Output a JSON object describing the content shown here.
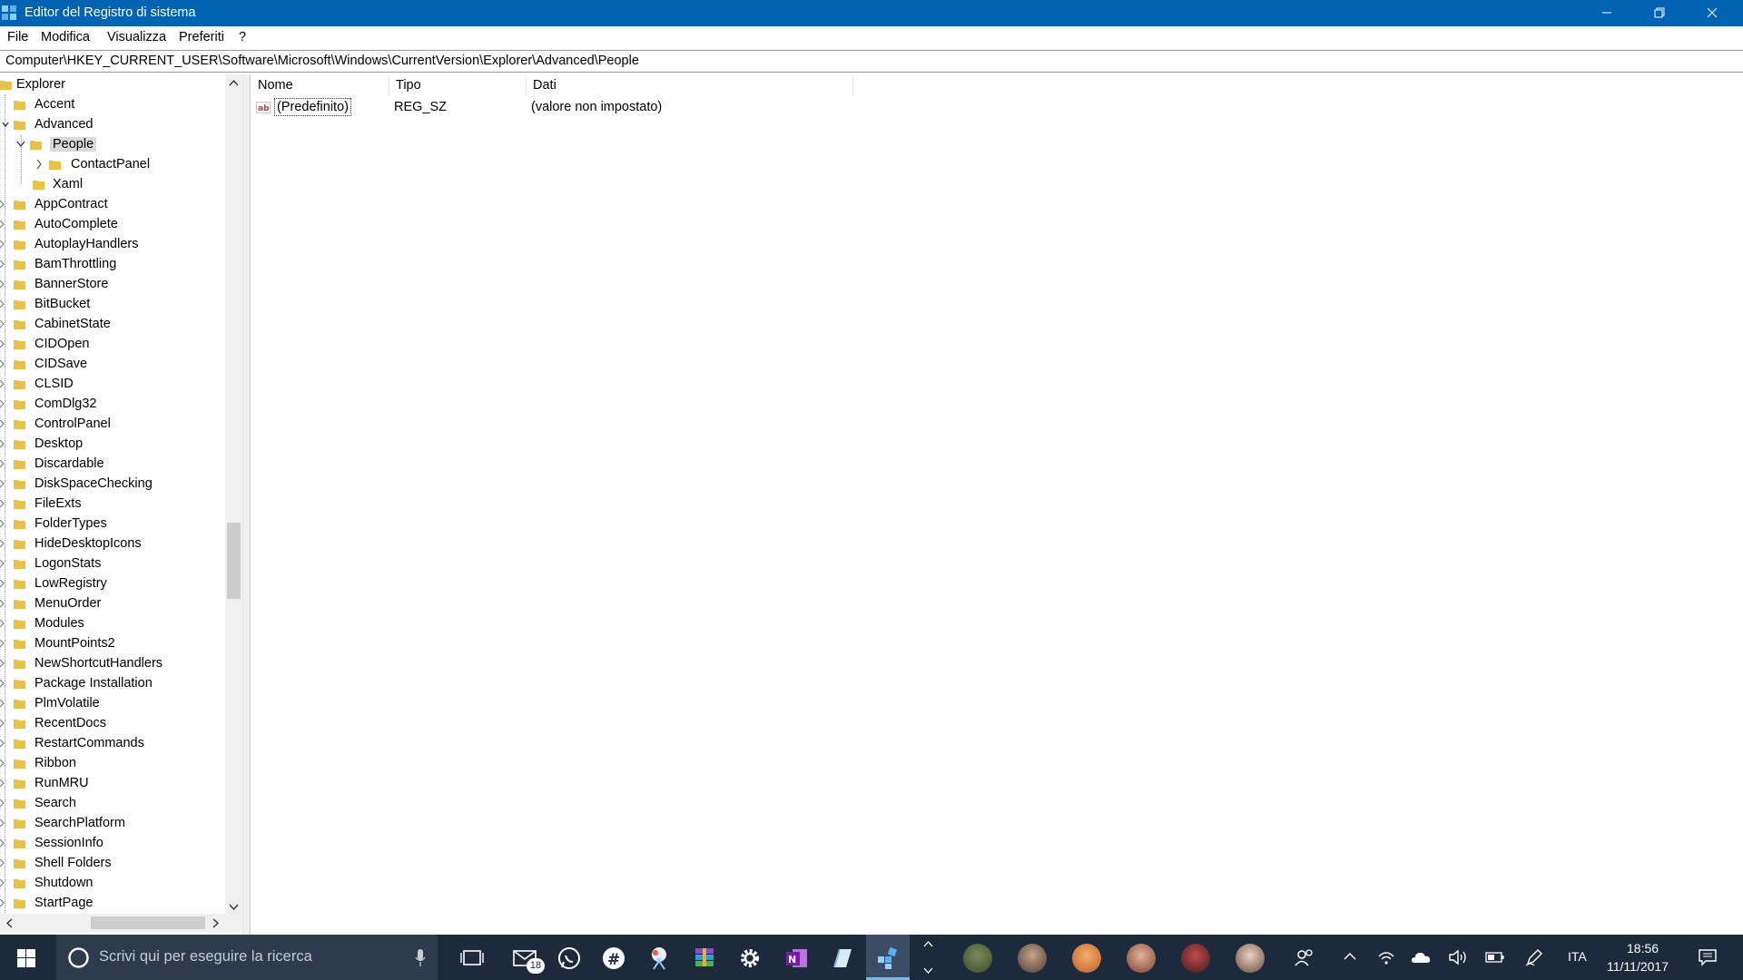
{
  "window": {
    "title": "Editor del Registro di sistema"
  },
  "menu": {
    "items": [
      "File",
      "Modifica",
      "Visualizza",
      "Preferiti",
      "?"
    ]
  },
  "address": {
    "path": "Computer\\HKEY_CURRENT_USER\\Software\\Microsoft\\Windows\\CurrentVersion\\Explorer\\Advanced\\People"
  },
  "tree": {
    "root": "Explorer",
    "accent": "Accent",
    "advanced": "Advanced",
    "people": "People",
    "contactpanel": "ContactPanel",
    "xaml": "Xaml",
    "siblings": [
      "AppContract",
      "AutoComplete",
      "AutoplayHandlers",
      "BamThrottling",
      "BannerStore",
      "BitBucket",
      "CabinetState",
      "CIDOpen",
      "CIDSave",
      "CLSID",
      "ComDlg32",
      "ControlPanel",
      "Desktop",
      "Discardable",
      "DiskSpaceChecking",
      "FileExts",
      "FolderTypes",
      "HideDesktopIcons",
      "LogonStats",
      "LowRegistry",
      "MenuOrder",
      "Modules",
      "MountPoints2",
      "NewShortcutHandlers",
      "Package Installation",
      "PlmVolatile",
      "RecentDocs",
      "RestartCommands",
      "Ribbon",
      "RunMRU",
      "Search",
      "SearchPlatform",
      "SessionInfo",
      "Shell Folders",
      "Shutdown",
      "StartPage"
    ]
  },
  "list": {
    "columns": {
      "name": "Nome",
      "type": "Tipo",
      "data": "Dati"
    },
    "rows": [
      {
        "name": "(Predefinito)",
        "type": "REG_SZ",
        "data": "(valore non impostato)"
      }
    ]
  },
  "taskbar": {
    "search_placeholder": "Scrivi qui per eseguire la ricerca",
    "mail_badge": "18",
    "language": "ITA",
    "time": "18:56",
    "date": "11/11/2017"
  },
  "colors": {
    "titlebar": "#0063b1",
    "taskbar": "#1c2a3c",
    "folder": "#e8c14b",
    "selection": "#d9d9d9"
  }
}
